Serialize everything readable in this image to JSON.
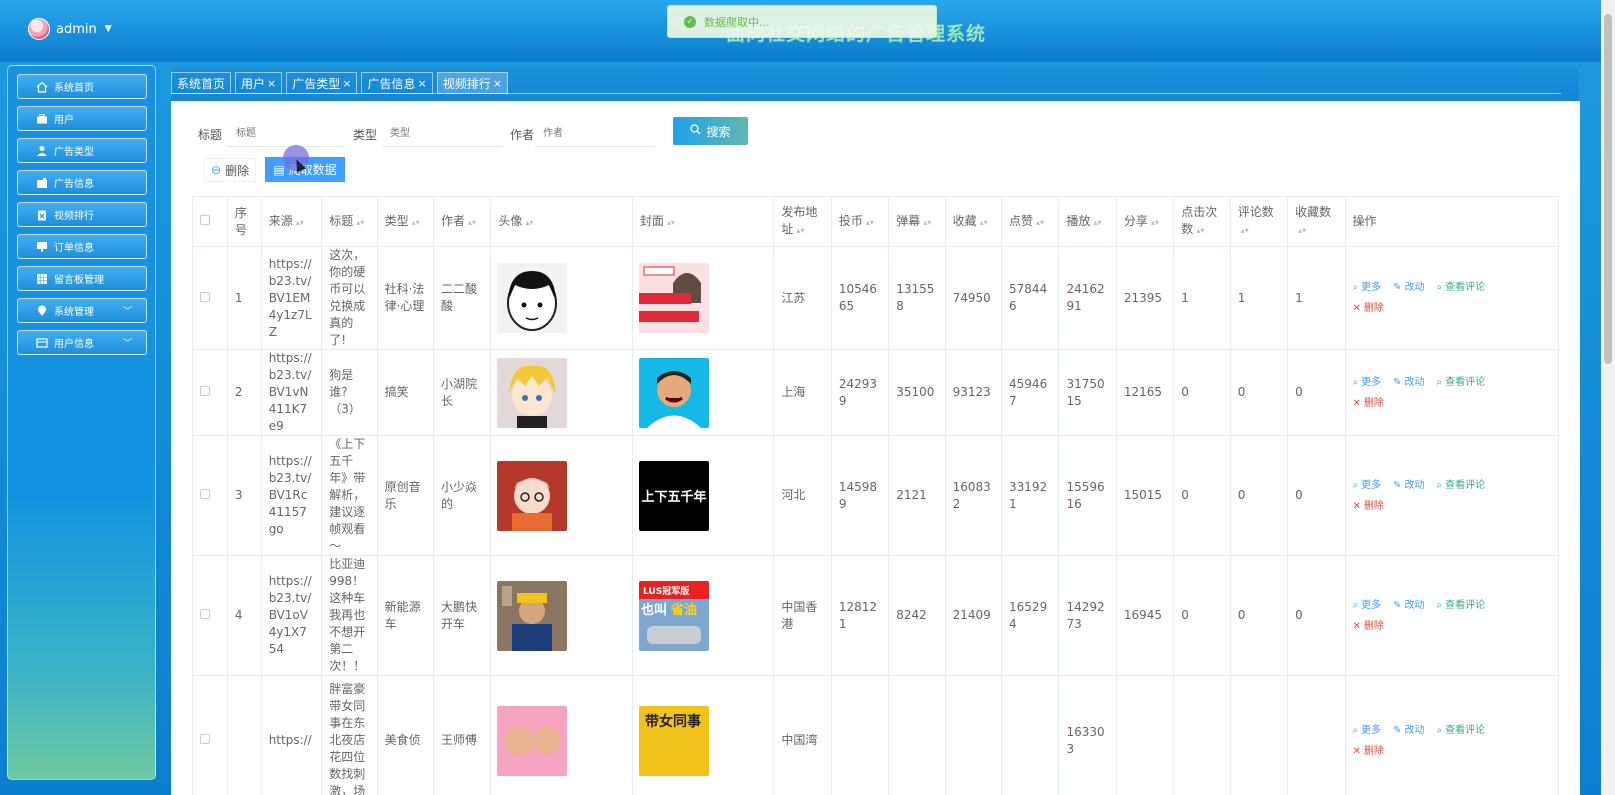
{
  "header": {
    "username": "admin",
    "app_title": "面向社交网络的广告管理系统",
    "toast": "数据爬取中..."
  },
  "sidebar": {
    "items": [
      {
        "label": "系统首页",
        "icon": "home-icon"
      },
      {
        "label": "用户",
        "icon": "briefcase-icon"
      },
      {
        "label": "广告类型",
        "icon": "user-icon"
      },
      {
        "label": "广告信息",
        "icon": "wallet-icon"
      },
      {
        "label": "视频排行",
        "icon": "clipboard-icon"
      },
      {
        "label": "订单信息",
        "icon": "display-icon"
      },
      {
        "label": "留言板管理",
        "icon": "grid-icon"
      },
      {
        "label": "系统管理",
        "icon": "location-icon"
      },
      {
        "label": "用户信息",
        "icon": "card-icon"
      }
    ]
  },
  "tabs": [
    {
      "label": "系统首页"
    },
    {
      "label": "用户",
      "close": "×"
    },
    {
      "label": "广告类型",
      "close": "×"
    },
    {
      "label": "广告信息",
      "close": "×"
    },
    {
      "label": "视频排行",
      "close": "×"
    }
  ],
  "search": {
    "title_label": "标题",
    "title_placeholder": "标题",
    "type_label": "类型",
    "type_placeholder": "类型",
    "author_label": "作者",
    "author_placeholder": "作者",
    "button": "搜索"
  },
  "actions": {
    "delete": "删除",
    "crawl": "爬取数据"
  },
  "table": {
    "headers": [
      "序号",
      "来源",
      "标题",
      "类型",
      "作者",
      "头像",
      "封面",
      "发布地址",
      "投币",
      "弹幕",
      "收藏",
      "点赞",
      "播放",
      "分享",
      "点击次数",
      "评论数",
      "收藏数",
      "操作"
    ],
    "op_labels": {
      "more": "更多",
      "edit": "改动",
      "comments": "查看评论",
      "delete": "删除"
    },
    "rows": [
      {
        "no": "1",
        "source": "https://b23.tv/BV1EM4y1z7LZ",
        "title": "这次，你的硬币可以兑换成真的了!",
        "type": "社科·法律·心理",
        "author": "二二酸酸",
        "address": "江苏",
        "coins": "1054665",
        "danmaku": "131558",
        "favorites": "74950",
        "likes": "578446",
        "plays": "2416291",
        "shares": "21395",
        "clicks": "1",
        "comments": "1",
        "fav_count": "1"
      },
      {
        "no": "2",
        "source": "https://b23.tv/BV1vN411K7e9",
        "title": "狗是谁?（3）",
        "type": "搞笑",
        "author": "小湖院长",
        "address": "上海",
        "coins": "242939",
        "danmaku": "35100",
        "favorites": "93123",
        "likes": "459467",
        "plays": "3175015",
        "shares": "12165",
        "clicks": "0",
        "comments": "0",
        "fav_count": "0"
      },
      {
        "no": "3",
        "source": "https://b23.tv/BV1Rc41157go",
        "title": "《上下五千年》带解析，建议逐帧观看～",
        "type": "原创音乐",
        "author": "小少焱的",
        "address": "河北",
        "coins": "145989",
        "danmaku": "2121",
        "favorites": "160832",
        "likes": "331921",
        "plays": "1559616",
        "shares": "15015",
        "clicks": "0",
        "comments": "0",
        "fav_count": "0"
      },
      {
        "no": "4",
        "source": "https://b23.tv/BV1oV4y1X754",
        "title": "比亚迪998！这种车我再也不想开第二次！！",
        "type": "新能源车",
        "author": "大鹏快开车",
        "address": "中国香港",
        "coins": "128121",
        "danmaku": "8242",
        "favorites": "21409",
        "likes": "165294",
        "plays": "1429273",
        "shares": "16945",
        "clicks": "0",
        "comments": "0",
        "fav_count": "0"
      },
      {
        "no": "",
        "source": "https://",
        "title": "胖富豪带女同事在东北夜店花四位数找刺激，场",
        "type": "美食侦",
        "author": "王师傅",
        "address": "中国湾",
        "coins": "",
        "danmaku": "",
        "favorites": "",
        "likes": "",
        "plays": "163303",
        "shares": "",
        "clicks": "",
        "comments": "",
        "fav_count": ""
      }
    ]
  }
}
